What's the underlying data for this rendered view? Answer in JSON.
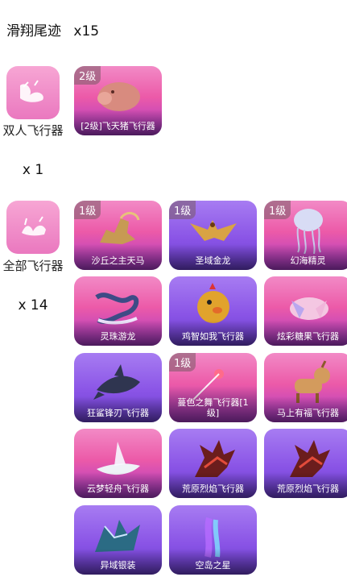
{
  "header": {
    "title": "滑翔尾迹",
    "count": "x15"
  },
  "categories": [
    {
      "label": "双人飞行器",
      "count": "x 1"
    },
    {
      "label": "全部飞行器",
      "count": "x 14"
    }
  ],
  "double_items": [
    {
      "name": "[2级]飞天猪飞行器",
      "badge": "2级",
      "theme": "pink",
      "icon": "pig-icon"
    }
  ],
  "all_items": [
    {
      "name": "沙丘之主天马",
      "badge": "1级",
      "theme": "pink",
      "icon": "pegasus-icon"
    },
    {
      "name": "圣域金龙",
      "badge": "1级",
      "theme": "purple",
      "icon": "golden-dragon-icon"
    },
    {
      "name": "幻海精灵",
      "badge": "1级",
      "theme": "pink",
      "icon": "jellyfish-icon"
    },
    {
      "name": "灵珠游龙",
      "badge": "",
      "theme": "pink",
      "icon": "serpent-dragon-icon"
    },
    {
      "name": "鸡智如我飞行器",
      "badge": "",
      "theme": "purple",
      "icon": "chicken-icon"
    },
    {
      "name": "炫彩糖果飞行器",
      "badge": "",
      "theme": "pink",
      "icon": "candy-icon"
    },
    {
      "name": "狂鲨锋刃飞行器",
      "badge": "",
      "theme": "purple",
      "icon": "shark-icon"
    },
    {
      "name": "蔓色之舞飞行器[1级]",
      "badge": "1级",
      "theme": "pink",
      "icon": "dance-spark-icon"
    },
    {
      "name": "马上有福飞行器",
      "badge": "",
      "theme": "pink",
      "icon": "horse-icon"
    },
    {
      "name": "云梦轻舟飞行器",
      "badge": "",
      "theme": "pink",
      "icon": "boat-icon"
    },
    {
      "name": "荒原烈焰飞行器",
      "badge": "",
      "theme": "purple",
      "icon": "flame-wing-icon"
    },
    {
      "name": "荒原烈焰飞行器",
      "badge": "",
      "theme": "purple",
      "icon": "flame-wing-icon"
    },
    {
      "name": "异域银装",
      "badge": "",
      "theme": "purple",
      "icon": "silver-wing-icon"
    },
    {
      "name": "空岛之星",
      "badge": "",
      "theme": "purple",
      "icon": "star-trail-icon"
    }
  ]
}
